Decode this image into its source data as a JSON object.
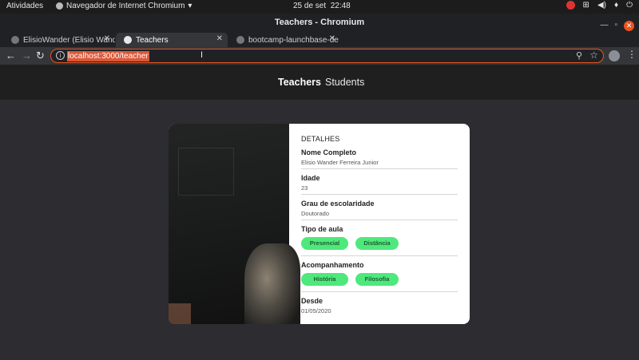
{
  "system_bar": {
    "activities": "Atividades",
    "app_name": "Navegador de Internet Chromium",
    "date": "25 de set",
    "time": "22:48"
  },
  "window": {
    "title": "Teachers - Chromium"
  },
  "tabs": [
    {
      "label": "ElisioWander (Elisio Wand"
    },
    {
      "label": "Teachers"
    },
    {
      "label": "bootcamp-launchbase-de"
    }
  ],
  "address_bar": {
    "url": "localhost:3000/teacher"
  },
  "nav": {
    "teachers": "Teachers",
    "students": "Students"
  },
  "card": {
    "heading": "DETALHES",
    "fields": [
      {
        "label": "Nome Completo",
        "value": "Elisio Wander Ferreira Junior"
      },
      {
        "label": "Idade",
        "value": "23"
      },
      {
        "label": "Grau de escolaridade",
        "value": "Doutorado"
      },
      {
        "label": "Tipo de aula",
        "pills": [
          "Presencial",
          "Distância"
        ]
      },
      {
        "label": "Acompanhamento",
        "pills": [
          "História",
          "Filosofia"
        ]
      },
      {
        "label": "Desde",
        "value": "01/05/2020"
      }
    ]
  },
  "colors": {
    "pill": "#4fe87c",
    "accent": "#e95420",
    "header_bg": "#1f1f1f",
    "page_bg": "#2d2c31"
  }
}
